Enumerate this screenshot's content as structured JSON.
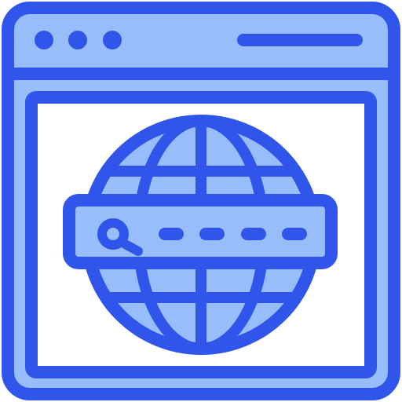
{
  "icon": {
    "name": "web-search-browser-icon",
    "colors": {
      "stroke": "#2f55ea",
      "fill_light": "#97bdfb",
      "fill_white": "#ffffff"
    },
    "browser": {
      "dots_count": 3,
      "has_address_line": true
    },
    "globe": {
      "has_search_bar": true,
      "search_placeholder_dashes": 4
    }
  }
}
